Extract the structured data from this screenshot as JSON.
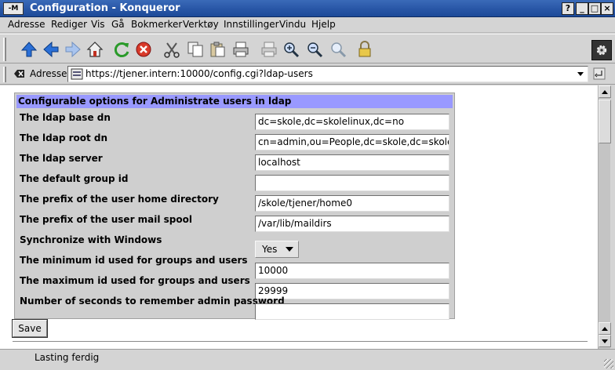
{
  "window": {
    "title": "Configuration - Konqueror",
    "app_icon": "-M",
    "buttons": [
      "?",
      "_",
      "□",
      "×"
    ]
  },
  "menu": [
    "Adresse",
    "Rediger",
    "Vis",
    "Gå",
    "Bokmerker",
    "Verktøy",
    "Innstillinger",
    "Vindu",
    "Hjelp"
  ],
  "toolbar": {
    "icons": [
      "up-arrow-icon",
      "back-arrow-icon",
      "forward-arrow-icon",
      "home-icon",
      "reload-icon",
      "stop-icon",
      "cut-icon",
      "copy-icon",
      "paste-icon",
      "print-icon",
      "print-frame-icon",
      "zoom-in-icon",
      "zoom-out-icon",
      "zoom-icon",
      "lock-icon",
      "gear-icon"
    ]
  },
  "location": {
    "label": "Adresse",
    "url": "https://tjener.intern:10000/config.cgi?ldap-users"
  },
  "form": {
    "header": "Configurable options for Administrate users in ldap",
    "rows": [
      {
        "label": "The ldap base dn",
        "value": "dc=skole,dc=skolelinux,dc=no"
      },
      {
        "label": "The ldap root dn",
        "value": "cn=admin,ou=People,dc=skole,dc=skolelinu"
      },
      {
        "label": "The ldap server",
        "value": "localhost"
      },
      {
        "label": "The default group id",
        "value": ""
      },
      {
        "label": "The prefix of the user home directory",
        "value": "/skole/tjener/home0"
      },
      {
        "label": "The prefix of the user mail spool",
        "value": "/var/lib/maildirs"
      },
      {
        "label": "Synchronize with Windows",
        "value": "Yes",
        "type": "select"
      },
      {
        "label": "The minimum id used for groups and users",
        "value": "10000"
      },
      {
        "label": "The maximum id used for groups and users",
        "value": "29999"
      },
      {
        "label": "Number of seconds to remember admin password",
        "value": ""
      }
    ],
    "save_label": "Save"
  },
  "status": {
    "text": "Lasting ferdig"
  },
  "colors": {
    "titlebar": "#2a58a8",
    "panel_header": "#9999ff",
    "panel_bg": "#cfcfcf"
  }
}
